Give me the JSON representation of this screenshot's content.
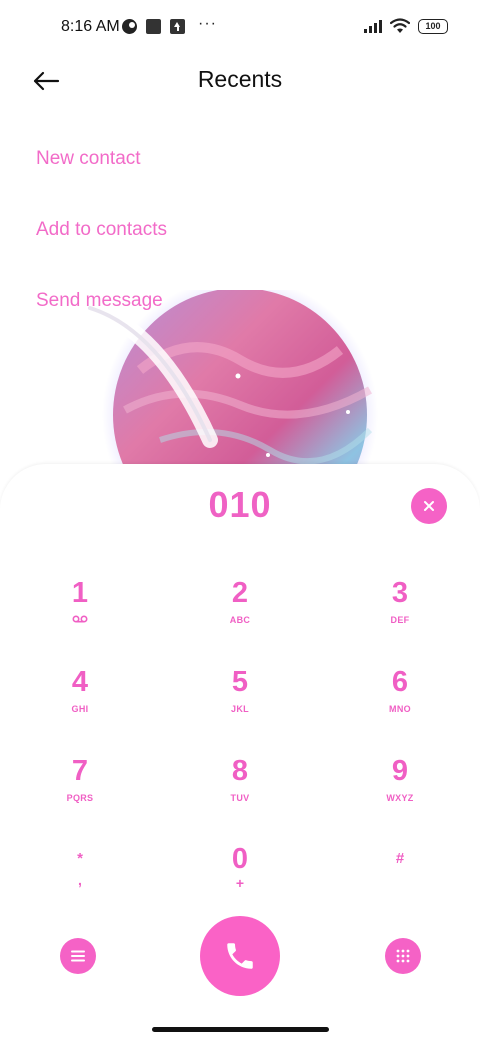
{
  "status": {
    "time": "8:16 AM",
    "battery": "100",
    "more": "···"
  },
  "header": {
    "title": "Recents"
  },
  "actions": [
    {
      "label": "New contact"
    },
    {
      "label": "Add to contacts"
    },
    {
      "label": "Send message"
    }
  ],
  "dialer": {
    "number": "010",
    "keys": [
      {
        "digit": "1",
        "letters": ""
      },
      {
        "digit": "2",
        "letters": "ABC"
      },
      {
        "digit": "3",
        "letters": "DEF"
      },
      {
        "digit": "4",
        "letters": "GHI"
      },
      {
        "digit": "5",
        "letters": "JKL"
      },
      {
        "digit": "6",
        "letters": "MNO"
      },
      {
        "digit": "7",
        "letters": "PQRS"
      },
      {
        "digit": "8",
        "letters": "TUV"
      },
      {
        "digit": "9",
        "letters": "WXYZ"
      },
      {
        "digit": "*",
        "letters": ","
      },
      {
        "digit": "0",
        "letters": "+"
      },
      {
        "digit": "#",
        "letters": ""
      }
    ]
  },
  "icons": {
    "back": "arrow-left-icon",
    "clear": "close-icon",
    "menu": "menu-icon",
    "call": "phone-icon",
    "keypad": "keypad-icon",
    "voicemail": "voicemail-icon"
  },
  "colors": {
    "accent": "#f562c6",
    "text": "#111111"
  }
}
